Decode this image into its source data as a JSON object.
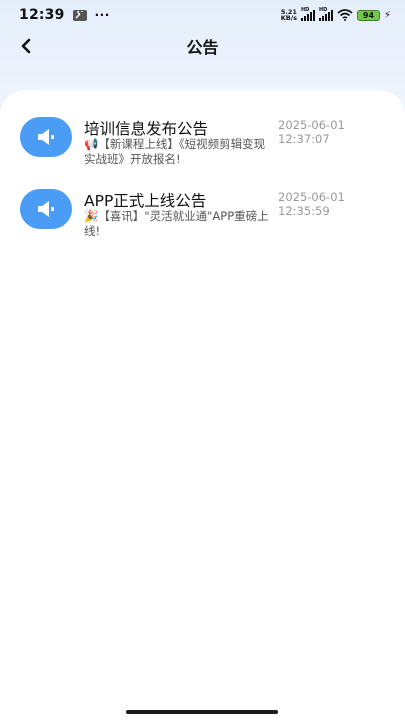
{
  "status_bar": {
    "time": "12:39",
    "dots": "···",
    "net_speed_value": "5.21",
    "net_speed_unit": "KB/s",
    "hd_label": "HD",
    "battery_level": "94",
    "icons": [
      "wrench-icon",
      "signal-icon",
      "wifi-icon",
      "battery-icon",
      "charging-bolt-icon"
    ]
  },
  "nav": {
    "back_icon": "chevron-left-icon",
    "title": "公告"
  },
  "notices": [
    {
      "icon": "megaphone-icon",
      "title": "培训信息发布公告",
      "preview": "📢【新课程上线】《短视频剪辑变现实战班》开放报名!",
      "date": "2025-06-01",
      "time": "12:37:07"
    },
    {
      "icon": "megaphone-icon",
      "title": "APP正式上线公告",
      "preview": "🎉【喜讯】\"灵活就业通\"APP重磅上线!",
      "date": "2025-06-01",
      "time": "12:35:59"
    }
  ],
  "colors": {
    "accent": "#4a9cf4",
    "header_bg": "#e4eefb",
    "battery": "#74c94a"
  }
}
